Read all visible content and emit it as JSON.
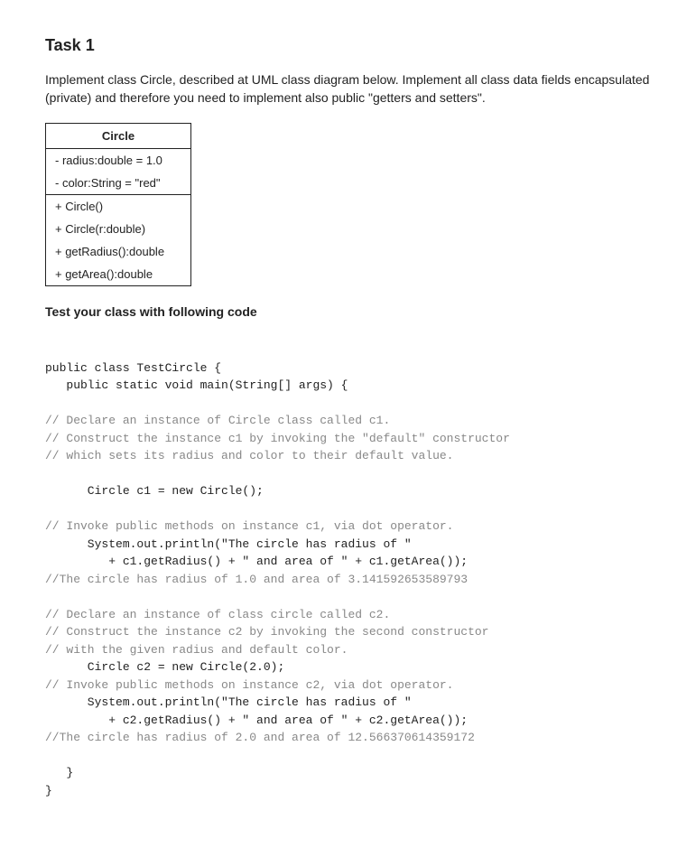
{
  "task": {
    "title": "Task 1",
    "description": "Implement class Circle, described at UML class diagram below. Implement all class data fields encapsulated (private) and therefore you need to implement also public \"getters and setters\"."
  },
  "uml": {
    "className": "Circle",
    "fields": [
      "- radius:double = 1.0",
      "- color:String = \"red\""
    ],
    "methods": [
      "+ Circle()",
      "+ Circle(r:double)",
      "+ getRadius():double",
      "+ getArea():double"
    ]
  },
  "testHeading": "Test your class with following code",
  "code": {
    "line1": "public class TestCircle {",
    "line2": "   public static void main(String[] args) {",
    "comment1": "// Declare an instance of Circle class called c1.",
    "comment2": "// Construct the instance c1 by invoking the \"default\" constructor",
    "comment3": "// which sets its radius and color to their default value.",
    "line3": "      Circle c1 = new Circle();",
    "comment4": "// Invoke public methods on instance c1, via dot operator.",
    "line4": "      System.out.println(\"The circle has radius of \"",
    "line5": "         + c1.getRadius() + \" and area of \" + c1.getArea());",
    "comment5": "//The circle has radius of 1.0 and area of 3.141592653589793",
    "comment6": "// Declare an instance of class circle called c2.",
    "comment7": "// Construct the instance c2 by invoking the second constructor",
    "comment8": "// with the given radius and default color.",
    "line6": "      Circle c2 = new Circle(2.0);",
    "comment9": "// Invoke public methods on instance c2, via dot operator.",
    "line7": "      System.out.println(\"The circle has radius of \"",
    "line8": "         + c2.getRadius() + \" and area of \" + c2.getArea());",
    "comment10": "//The circle has radius of 2.0 and area of 12.566370614359172",
    "line9": "   }",
    "line10": "}"
  }
}
